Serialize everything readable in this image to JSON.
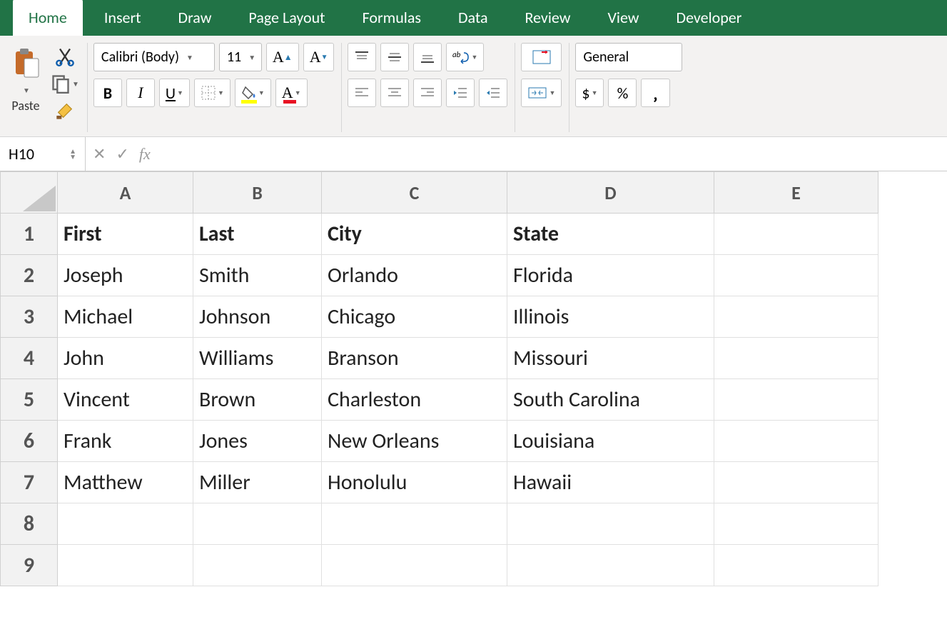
{
  "tabs": [
    "Home",
    "Insert",
    "Draw",
    "Page Layout",
    "Formulas",
    "Data",
    "Review",
    "View",
    "Developer"
  ],
  "active_tab": "Home",
  "ribbon": {
    "paste_label": "Paste",
    "font_name": "Calibri (Body)",
    "font_size": "11",
    "number_format": "General",
    "currency": "$",
    "percent": "%"
  },
  "formula_bar": {
    "name_box": "H10",
    "fx_label": "fx",
    "value": ""
  },
  "columns": [
    "A",
    "B",
    "C",
    "D",
    "E"
  ],
  "row_count": 9,
  "headers": [
    "First",
    "Last",
    "City",
    "State"
  ],
  "rows": [
    {
      "first": "Joseph",
      "last": "Smith",
      "city": "Orlando",
      "state": "Florida"
    },
    {
      "first": "Michael",
      "last": "Johnson",
      "city": "Chicago",
      "state": "Illinois"
    },
    {
      "first": "John",
      "last": "Williams",
      "city": "Branson",
      "state": "Missouri"
    },
    {
      "first": "Vincent",
      "last": "Brown",
      "city": "Charleston",
      "state": "South Carolina"
    },
    {
      "first": "Frank",
      "last": "Jones",
      "city": "New Orleans",
      "state": "Louisiana"
    },
    {
      "first": "Matthew",
      "last": "Miller",
      "city": "Honolulu",
      "state": "Hawaii"
    }
  ]
}
